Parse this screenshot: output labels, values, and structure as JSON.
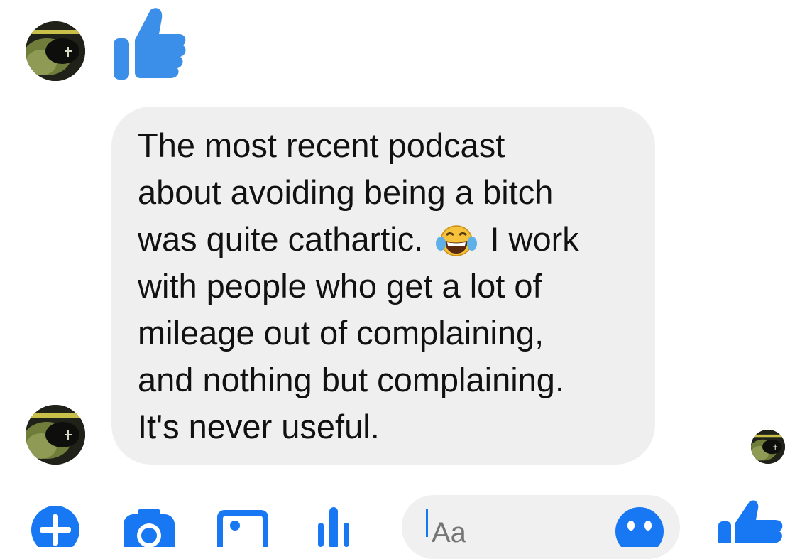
{
  "thread": {
    "sent_reaction_icon": "thumbs-up-icon",
    "message": {
      "lines": [
        "The most recent podcast",
        "about avoiding being a bitch",
        "was quite cathartic.",
        "I work",
        "with people who get a lot of",
        "mileage out of complaining,",
        "and nothing but complaining.",
        "It's never useful."
      ],
      "inline_emoji": "tears-of-joy-emoji"
    }
  },
  "composer": {
    "icons": [
      "plus-icon",
      "camera-icon",
      "photo-icon",
      "mic-icon",
      "smiley-icon",
      "thumbs-up-icon"
    ],
    "input_placeholder": "Aa"
  },
  "colors": {
    "accent": "#1877f2",
    "bubble": "#efefef",
    "text": "#111111"
  }
}
